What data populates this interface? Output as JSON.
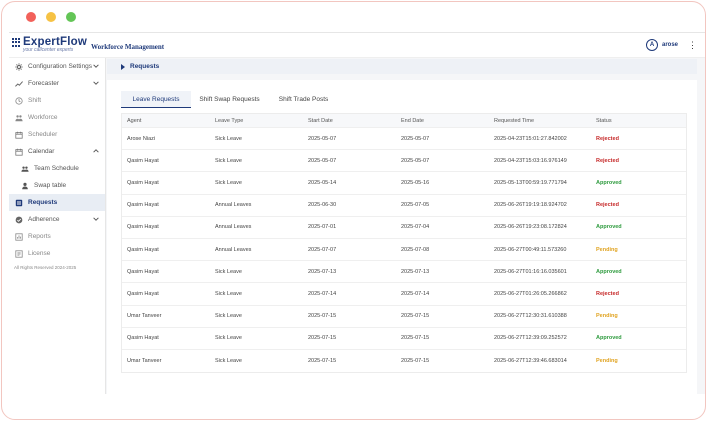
{
  "app": {
    "logo_text": "ExpertFlow",
    "logo_tagline": "your callcenter experts",
    "title": "Workforce Management",
    "user_initial": "A",
    "username": "arose"
  },
  "sidebar": {
    "items": [
      {
        "label": "Configuration Settings",
        "icon": "gear-icon",
        "chevron": "down"
      },
      {
        "label": "Forecaster",
        "icon": "trend-icon",
        "chevron": "down"
      },
      {
        "label": "Shift",
        "icon": "clock-icon",
        "disabled": true
      },
      {
        "label": "Workforce",
        "icon": "workforce-icon",
        "disabled": true
      },
      {
        "label": "Scheduler",
        "icon": "calendar-icon",
        "disabled": true
      },
      {
        "label": "Calendar",
        "icon": "calendar-icon",
        "chevron": "up"
      },
      {
        "label": "Team Schedule",
        "icon": "group-icon",
        "sub": true
      },
      {
        "label": "Swap table",
        "icon": "person-icon",
        "sub": true
      },
      {
        "label": "Requests",
        "icon": "list-icon",
        "active": true
      },
      {
        "label": "Adherence",
        "icon": "check-circle-icon",
        "chevron": "down"
      },
      {
        "label": "Reports",
        "icon": "report-icon",
        "disabled": true
      },
      {
        "label": "License",
        "icon": "license-icon",
        "disabled": true
      }
    ],
    "footer": "All Rights Reserved 2024-2025"
  },
  "breadcrumb": "Requests",
  "tabs": [
    {
      "label": "Leave Requests",
      "active": true
    },
    {
      "label": "Shift Swap Requests"
    },
    {
      "label": "Shift Trade Posts"
    }
  ],
  "table": {
    "headers": [
      "Agent",
      "Leave Type",
      "Start Date",
      "End Date",
      "Requested Time",
      "Status"
    ],
    "rows": [
      [
        "Arose Niazi",
        "Sick Leave",
        "2025-05-07",
        "2025-05-07",
        "2025-04-23T15:01:27.842002",
        "Rejected"
      ],
      [
        "Qasim Hayat",
        "Sick Leave",
        "2025-05-07",
        "2025-05-07",
        "2025-04-23T15:03:16.976149",
        "Rejected"
      ],
      [
        "Qasim Hayat",
        "Sick Leave",
        "2025-05-14",
        "2025-05-16",
        "2025-05-13T00:59:19.771794",
        "Approved"
      ],
      [
        "Qasim Hayat",
        "Annual Leaves",
        "2025-06-30",
        "2025-07-05",
        "2025-06-26T19:19:18.924702",
        "Rejected"
      ],
      [
        "Qasim Hayat",
        "Annual Leaves",
        "2025-07-01",
        "2025-07-04",
        "2025-06-26T19:23:08.172824",
        "Approved"
      ],
      [
        "Qasim Hayat",
        "Annual Leaves",
        "2025-07-07",
        "2025-07-08",
        "2025-06-27T00:49:11.573260",
        "Pending"
      ],
      [
        "Qasim Hayat",
        "Sick Leave",
        "2025-07-13",
        "2025-07-13",
        "2025-06-27T01:16:16.035601",
        "Approved"
      ],
      [
        "Qasim Hayat",
        "Sick Leave",
        "2025-07-14",
        "2025-07-14",
        "2025-06-27T01:26:05.266862",
        "Rejected"
      ],
      [
        "Umar Tanveer",
        "Sick Leave",
        "2025-07-15",
        "2025-07-15",
        "2025-06-27T12:30:31.610388",
        "Pending"
      ],
      [
        "Qasim Hayat",
        "Sick Leave",
        "2025-07-15",
        "2025-07-15",
        "2025-06-27T12:39:09.252572",
        "Approved"
      ],
      [
        "Umar Tanveer",
        "Sick Leave",
        "2025-07-15",
        "2025-07-15",
        "2025-06-27T12:39:46.683014",
        "Pending"
      ]
    ]
  },
  "colors": {
    "brand": "#1f3a7a",
    "rejected": "#c62828",
    "approved": "#2e9b3e",
    "pending": "#e0a321"
  }
}
